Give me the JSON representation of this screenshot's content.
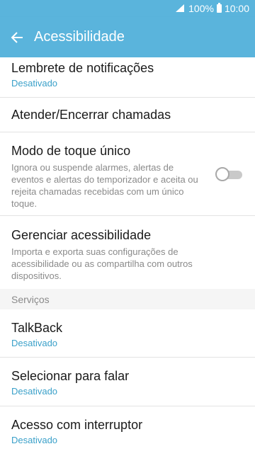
{
  "status_bar": {
    "battery": "100%",
    "time": "10:00"
  },
  "app_bar": {
    "title": "Acessibilidade"
  },
  "items_top": [
    {
      "title": "Lembrete de notificações",
      "subtitle": "Desativado"
    },
    {
      "title": "Atender/Encerrar chamadas"
    },
    {
      "title": "Modo de toque único",
      "description": "Ignora ou suspende alarmes, alertas de eventos e alertas do temporizador e aceita ou rejeita chamadas recebidas com um único toque.",
      "toggle": "off"
    },
    {
      "title": "Gerenciar acessibilidade",
      "description": "Importa e exporta suas configurações de acessibilidade ou as compartilha com outros dispositivos."
    }
  ],
  "section_services": {
    "header": "Serviços"
  },
  "items_services": [
    {
      "title": "TalkBack",
      "subtitle": "Desativado"
    },
    {
      "title": "Selecionar para falar",
      "subtitle": "Desativado"
    },
    {
      "title": "Acesso com interruptor",
      "subtitle": "Desativado"
    }
  ],
  "colors": {
    "accent": "#5ab4dc",
    "subtitle": "#3aa0c9"
  },
  "icons": {
    "back": "arrow-left-icon",
    "signal": "signal-icon",
    "battery": "battery-icon"
  }
}
